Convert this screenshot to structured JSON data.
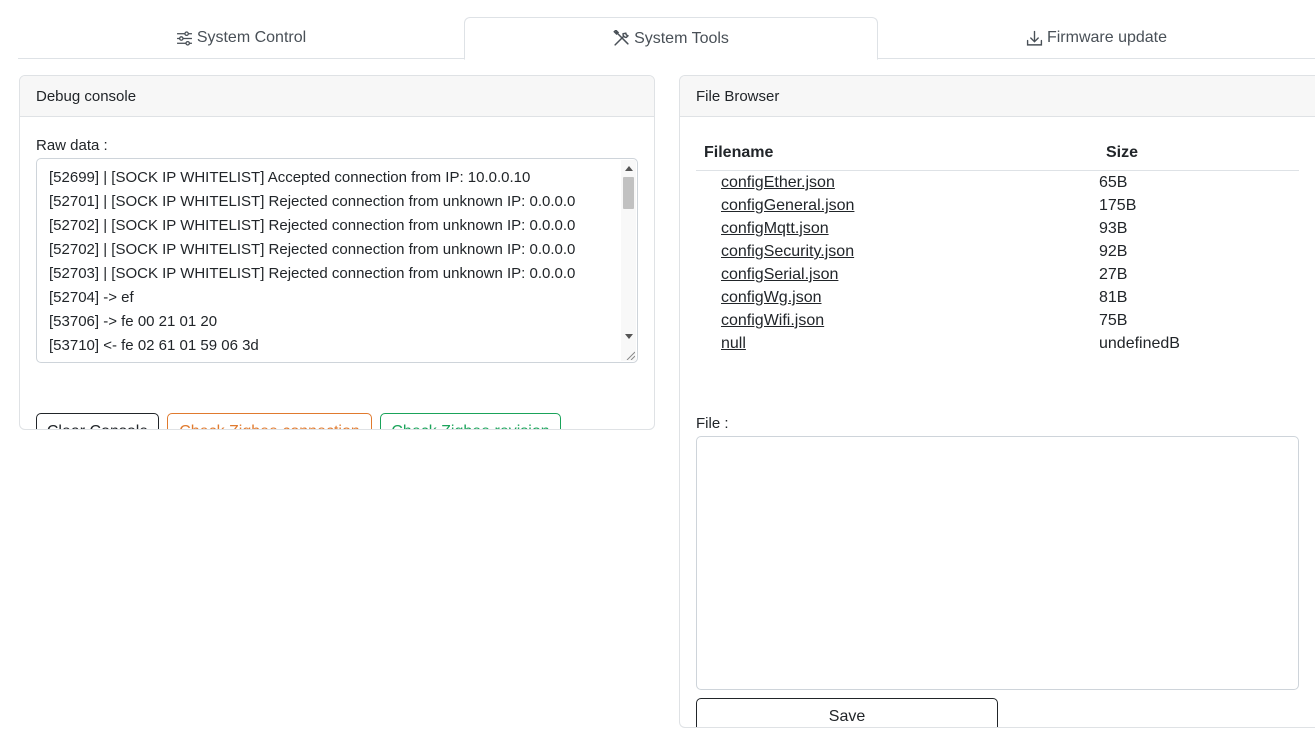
{
  "tabs": [
    {
      "label": "System Control",
      "icon": "sliders-icon",
      "active": false
    },
    {
      "label": "System Tools",
      "icon": "tools-icon",
      "active": true
    },
    {
      "label": "Firmware update",
      "icon": "download-icon",
      "active": false
    }
  ],
  "debug": {
    "title": "Debug console",
    "raw_label": "Raw data :",
    "lines": [
      "[52699] | [SOCK IP WHITELIST] Accepted connection from IP: 10.0.0.10",
      "[52701] | [SOCK IP WHITELIST] Rejected connection from unknown IP: 0.0.0.0",
      "[52702] | [SOCK IP WHITELIST] Rejected connection from unknown IP: 0.0.0.0",
      "[52702] | [SOCK IP WHITELIST] Rejected connection from unknown IP: 0.0.0.0",
      "[52703] | [SOCK IP WHITELIST] Rejected connection from unknown IP: 0.0.0.0",
      "[52704] -> ef",
      "[53706] -> fe 00 21 01 20",
      "[53710] <- fe 02 61 01 59 06 3d"
    ],
    "buttons": {
      "clear": "Clear Console",
      "check_connection": "Check Zigbee connection",
      "check_revision": "Check Zigbee revision"
    },
    "colors": {
      "warning": "#e07a2e",
      "success": "#1aa35a",
      "dark": "#212529"
    }
  },
  "file_browser": {
    "title": "File Browser",
    "columns": {
      "name": "Filename",
      "size": "Size"
    },
    "files": [
      {
        "name": "configEther.json",
        "size": "65B"
      },
      {
        "name": "configGeneral.json",
        "size": "175B"
      },
      {
        "name": "configMqtt.json",
        "size": "93B"
      },
      {
        "name": "configSecurity.json",
        "size": "92B"
      },
      {
        "name": "configSerial.json",
        "size": "27B"
      },
      {
        "name": "configWg.json",
        "size": "81B"
      },
      {
        "name": "configWifi.json",
        "size": "75B"
      },
      {
        "name": "null",
        "size": "undefinedB"
      }
    ],
    "file_label": "File :",
    "editor_value": "",
    "save_label": "Save"
  }
}
